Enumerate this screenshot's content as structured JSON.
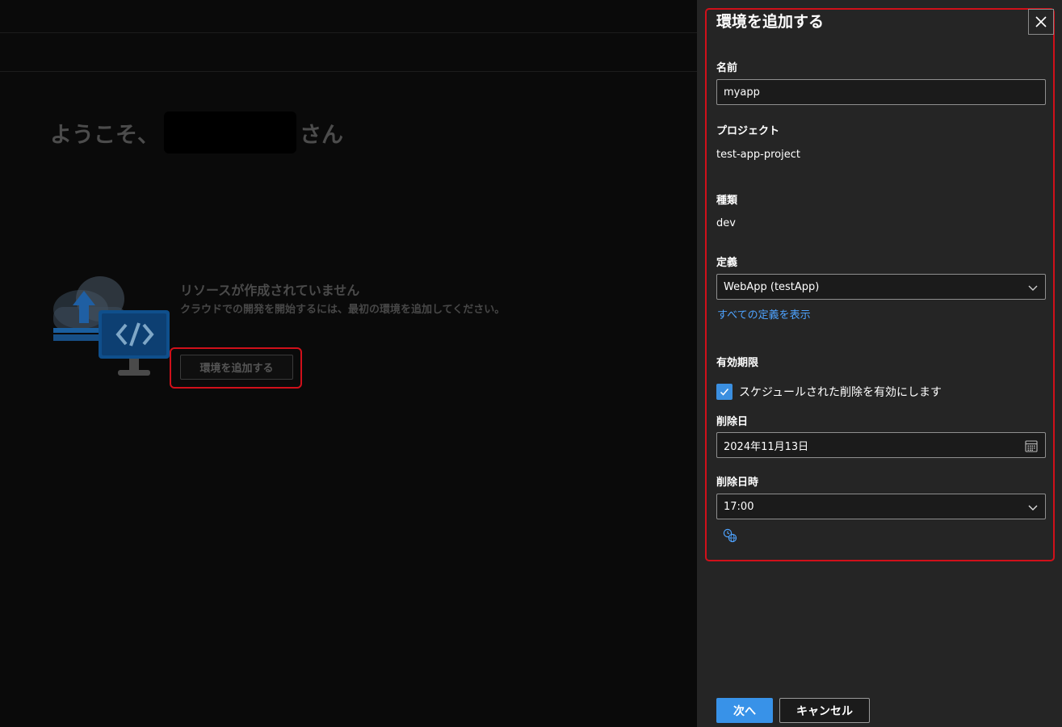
{
  "background": {
    "welcome_prefix": "ようこそ、",
    "welcome_suffix": "さん",
    "empty_title": "リソースが作成されていません",
    "empty_desc": "クラウドでの開発を開始するには、最初の環境を追加してください。",
    "add_env_label": "環境を追加する"
  },
  "panel": {
    "title": "環境を追加する",
    "name_label": "名前",
    "name_value": "myapp",
    "project_label": "プロジェクト",
    "project_value": "test-app-project",
    "type_label": "種類",
    "type_value": "dev",
    "definition_label": "定義",
    "definition_value": "WebApp (testApp)",
    "show_all_definitions": "すべての定義を表示",
    "expiration_label": "有効期限",
    "schedule_delete_label": "スケジュールされた削除を有効にします",
    "schedule_delete_checked": true,
    "delete_date_label": "削除日",
    "delete_date_value": "2024年11月13日",
    "delete_time_label": "削除日時",
    "delete_time_value": "17:00",
    "next_label": "次へ",
    "cancel_label": "キャンセル"
  },
  "colors": {
    "accent": "#3892e8",
    "link": "#4ea3ff",
    "highlight": "#d0101a",
    "panel_bg": "#252525",
    "page_bg": "#0a0a0a"
  },
  "icons": [
    "close-icon",
    "chevron-down-icon",
    "calendar-icon",
    "checkmark-icon",
    "timezone-globe-icon",
    "cloud-upload-code-illustration"
  ]
}
